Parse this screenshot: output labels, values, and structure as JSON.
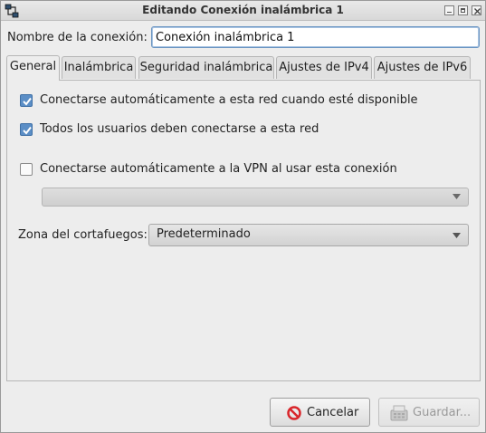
{
  "window": {
    "title": "Editando Conexión inalámbrica 1",
    "app_icon": "network-connection-icon",
    "controls": [
      "minimize-icon",
      "maximize-icon",
      "close-icon"
    ]
  },
  "connection_name": {
    "label": "Nombre de la conexión:",
    "value": "Conexión inalámbrica 1"
  },
  "tabs": [
    {
      "label": "General",
      "active": true
    },
    {
      "label": "Inalámbrica",
      "active": false
    },
    {
      "label": "Seguridad inalámbrica",
      "active": false
    },
    {
      "label": "Ajustes de IPv4",
      "active": false
    },
    {
      "label": "Ajustes de IPv6",
      "active": false
    }
  ],
  "general": {
    "auto_connect": {
      "label": "Conectarse automáticamente a esta red cuando esté disponible",
      "checked": true
    },
    "all_users": {
      "label": "Todos los usuarios deben conectarse a esta red",
      "checked": true
    },
    "auto_vpn": {
      "label": "Conectarse automáticamente a la VPN al usar esta conexión",
      "checked": false
    },
    "vpn_combo": {
      "value": "",
      "enabled": false
    },
    "firewall_zone": {
      "label": "Zona del cortafuegos:",
      "value": "Predeterminado"
    }
  },
  "buttons": {
    "cancel": {
      "label": "Cancelar",
      "icon": "cancel-icon",
      "enabled": true
    },
    "save": {
      "label": "Guardar...",
      "icon": "save-icon",
      "enabled": false
    }
  },
  "colors": {
    "accent": "#5b8ec6",
    "cancel_icon": "#d9262b"
  }
}
